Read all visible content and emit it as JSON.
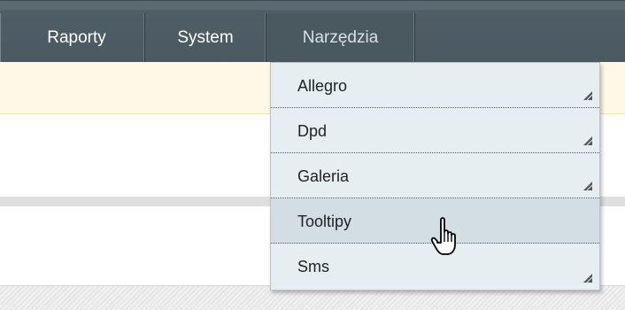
{
  "nav": {
    "items": [
      {
        "label": "Raporty"
      },
      {
        "label": "System"
      },
      {
        "label": "Narzędzia"
      }
    ]
  },
  "dropdown": {
    "items": [
      {
        "label": "Allegro",
        "has_submenu": true
      },
      {
        "label": "Dpd",
        "has_submenu": true
      },
      {
        "label": "Galeria",
        "has_submenu": true
      },
      {
        "label": "Tooltipy",
        "has_submenu": false,
        "hovered": true
      },
      {
        "label": "Sms",
        "has_submenu": true
      }
    ]
  },
  "colors": {
    "navbar": "#4b5961",
    "dropdown_bg": "#e6eef2",
    "dropdown_hover": "#d2dee3",
    "notice_bg": "#fff8e6"
  },
  "cursor": {
    "icon": "hand-pointer-icon"
  }
}
